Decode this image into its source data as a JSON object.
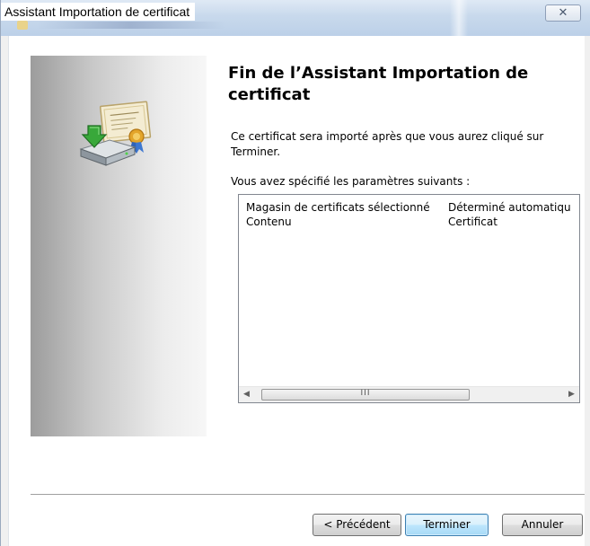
{
  "window": {
    "title": "Assistant Importation de certificat",
    "close_glyph": "✕"
  },
  "wizard": {
    "heading": "Fin de l’Assistant Importation de certificat",
    "intro": "Ce certificat sera importé après que vous aurez cliqué sur Terminer.",
    "params_label": "Vous avez spécifié les paramètres suivants :",
    "icon": "certificate-import-icon"
  },
  "params": {
    "rows": [
      {
        "name": "Magasin de certificats sélectionné",
        "value": "Déterminé automatiqu"
      },
      {
        "name": "Contenu",
        "value": "Certificat"
      }
    ]
  },
  "scrollbar": {
    "left_glyph": "◀",
    "right_glyph": "▶",
    "grip": "III"
  },
  "buttons": {
    "back": "< Précédent",
    "finish": "Terminer",
    "cancel": "Annuler"
  },
  "colors": {
    "default_button_border": "#3c7fb1",
    "titlebar": "#c8d9ec"
  }
}
